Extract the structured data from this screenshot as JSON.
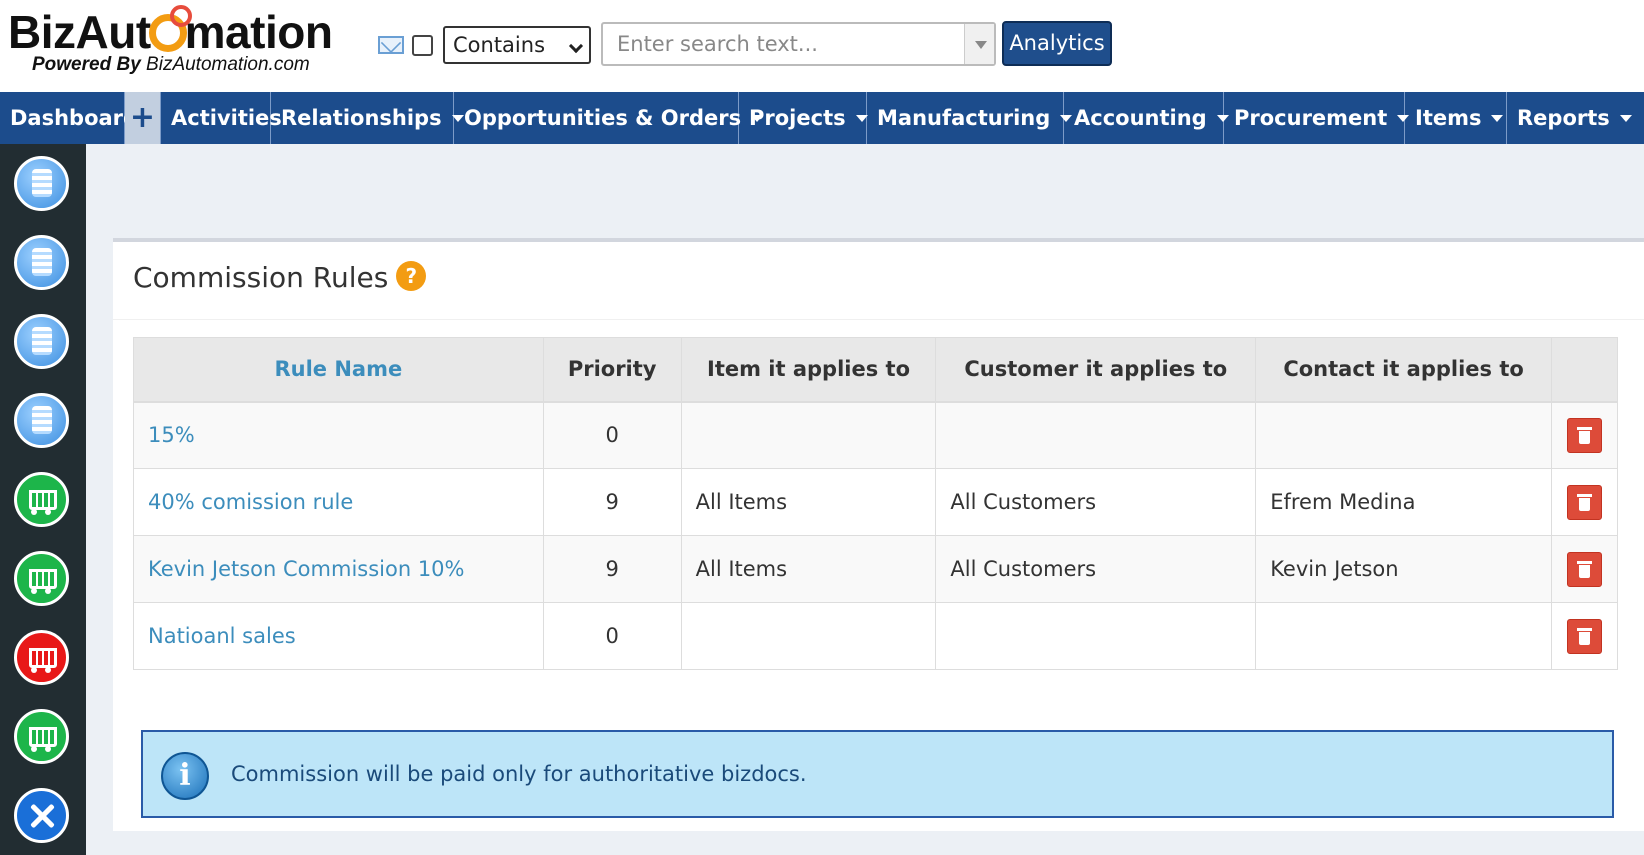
{
  "brand": {
    "logo_left": "BizAut",
    "logo_right": "mation",
    "powered_prefix": "Powered By",
    "powered_site": "BizAutomation.com"
  },
  "search": {
    "mode": "Contains",
    "placeholder": "Enter search text...",
    "analytics_label": "Analytics"
  },
  "nav": {
    "dashboard": "Dashboard",
    "plus": "+",
    "activities": "Activities",
    "relationships": "Relationships",
    "opportunities": "Opportunities & Orders",
    "projects": "Projects",
    "manufacturing": "Manufacturing",
    "accounting": "Accounting",
    "procurement": "Procurement",
    "items": "Items",
    "reports": "Reports"
  },
  "sidebar": {
    "icons": [
      "database-icon",
      "database-icon",
      "database-icon",
      "database-icon",
      "cart-icon",
      "cart-icon",
      "cart-red-icon",
      "cart-icon",
      "tools-icon"
    ]
  },
  "page": {
    "title": "Commission Rules",
    "help": "?"
  },
  "table": {
    "headers": {
      "rule_name": "Rule Name",
      "priority": "Priority",
      "item": "Item it applies to",
      "customer": "Customer it applies to",
      "contact": "Contact it applies to"
    },
    "rows": [
      {
        "name": "15%",
        "priority": "0",
        "item": "",
        "customer": "",
        "contact": ""
      },
      {
        "name": "40% comission rule",
        "priority": "9",
        "item": "All Items",
        "customer": "All Customers",
        "contact": "Efrem Medina"
      },
      {
        "name": "Kevin Jetson Commission 10%",
        "priority": "9",
        "item": "All Items",
        "customer": "All Customers",
        "contact": "Kevin Jetson"
      },
      {
        "name": "Natioanl sales",
        "priority": "0",
        "item": "",
        "customer": "",
        "contact": ""
      }
    ]
  },
  "notice": {
    "icon": "i",
    "text": "Commission will be paid only for authoritative bizdocs."
  },
  "colors": {
    "nav_bg": "#1c4c8c",
    "link": "#3c8dbc",
    "danger": "#dd4b39",
    "info_bg": "#bde5f8"
  }
}
